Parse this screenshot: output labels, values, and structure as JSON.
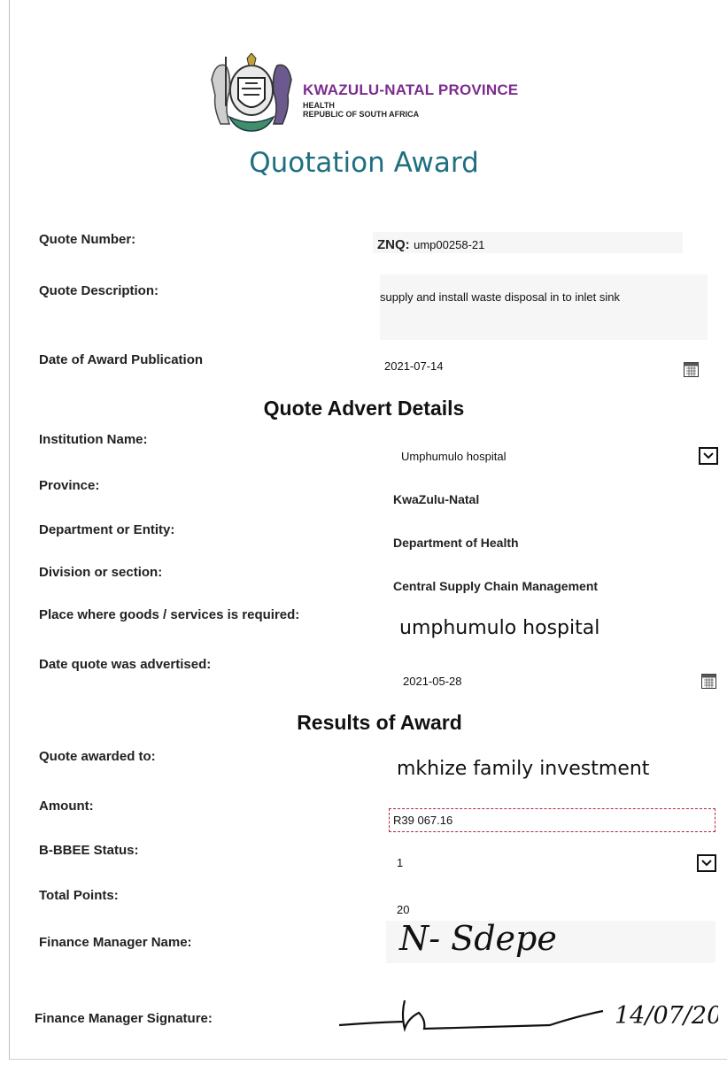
{
  "header": {
    "province": "KWAZULU-NATAL PROVINCE",
    "dept": "HEALTH",
    "country": "REPUBLIC OF SOUTH AFRICA",
    "title": "Quotation Award"
  },
  "quote": {
    "number_label": "Quote Number:",
    "number_prefix": "ZNQ:",
    "number_value": "ump00258-21",
    "desc_label": "Quote Description:",
    "desc_value": "supply and install waste disposal in to inlet sink",
    "pub_label": "Date of Award Publication",
    "pub_value": "2021-07-14"
  },
  "advert": {
    "heading": "Quote Advert Details",
    "institution_label": "Institution Name:",
    "institution_value": "Umphumulo hospital",
    "province_label": "Province:",
    "province_value": "KwaZulu-Natal",
    "department_label": "Department or Entity:",
    "department_value": "Department of Health",
    "division_label": "Division or section:",
    "division_value": "Central Supply Chain Management",
    "place_label": "Place where goods /  services is required:",
    "place_value": "umphumulo hospital",
    "advertised_label": "Date quote was advertised:",
    "advertised_value": "2021-05-28"
  },
  "results": {
    "heading": "Results of Award",
    "awarded_label": "Quote awarded to:",
    "awarded_value": "mkhize family investment",
    "amount_label": "Amount:",
    "amount_value": "R39 067.16",
    "bbbee_label": "B-BBEE Status:",
    "bbbee_value": "1",
    "points_label": "Total Points:",
    "points_value": "20",
    "fm_name_label": "Finance Manager Name:",
    "fm_name_value": "N- Sdepe",
    "fm_sig_label": "Finance Manager Signature:",
    "fm_sig_date": "14/07/20"
  },
  "icons": {
    "calendar": "calendar-icon",
    "dropdown": "chevron-down-icon",
    "crest": "coat-of-arms-logo"
  },
  "colors": {
    "title": "#1f6f80",
    "province": "#7b2d8e",
    "dotted_border": "#b02a3a"
  }
}
